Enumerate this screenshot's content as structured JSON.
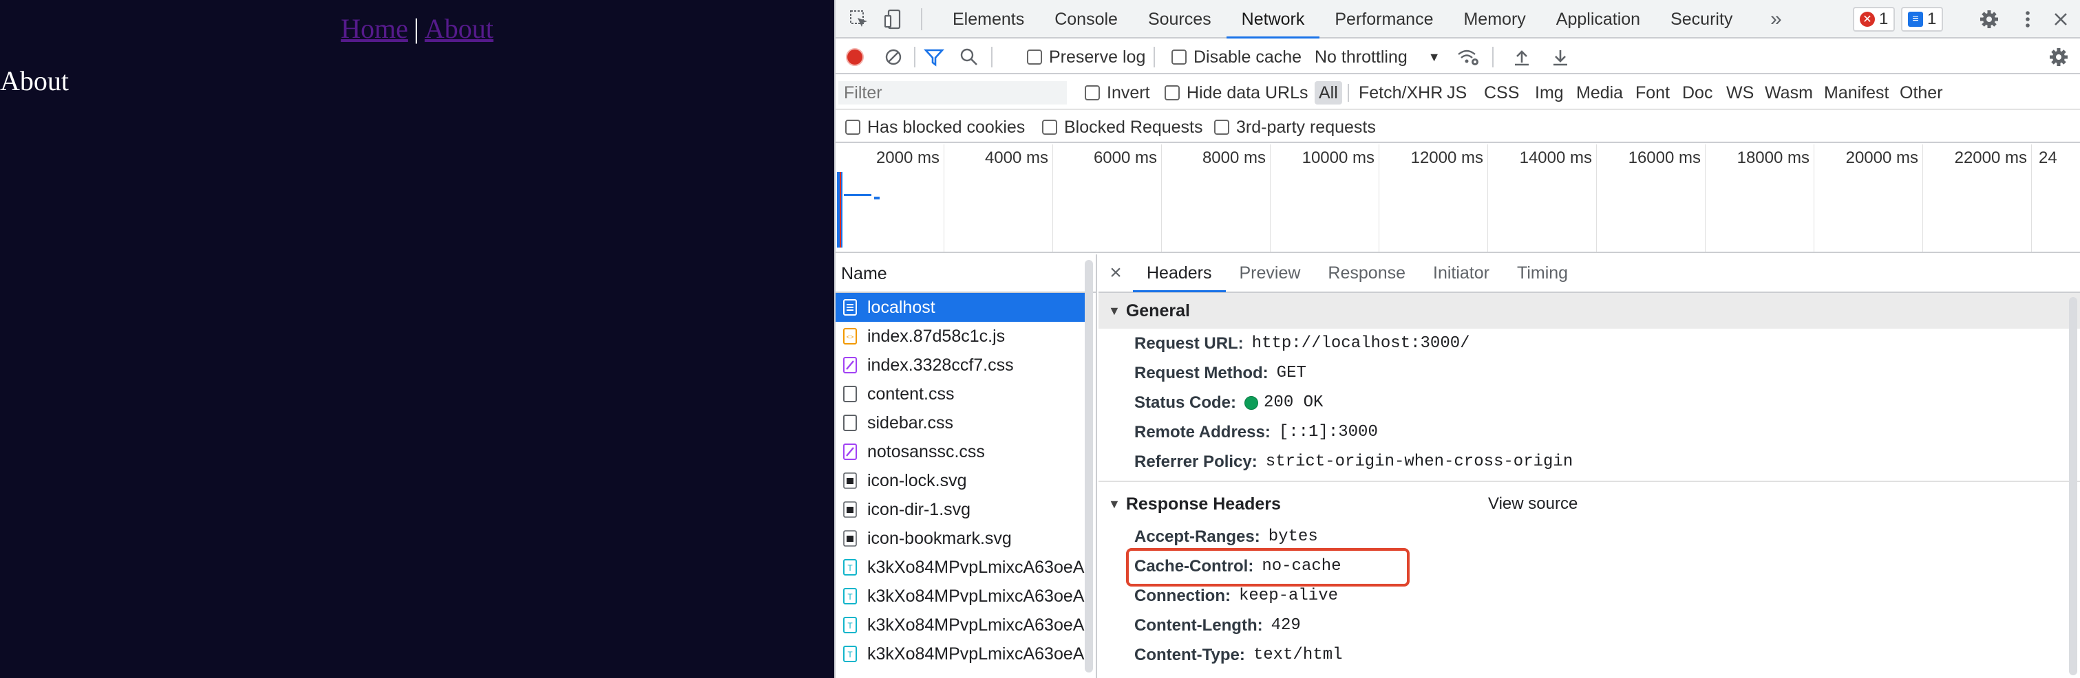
{
  "app": {
    "nav_home": "Home",
    "nav_separator": "|",
    "nav_about": "About",
    "heading": "About"
  },
  "devtools": {
    "tabs": [
      "Elements",
      "Console",
      "Sources",
      "Network",
      "Performance",
      "Memory",
      "Application",
      "Security"
    ],
    "active_tab": "Network",
    "more_tabs": "»",
    "error_count": "1",
    "message_count": "1",
    "toolbar": {
      "preserve_log": "Preserve log",
      "disable_cache": "Disable cache",
      "throttling": "No throttling"
    },
    "filter": {
      "placeholder": "Filter",
      "invert": "Invert",
      "hide_data_urls": "Hide data URLs",
      "types": [
        "All",
        "Fetch/XHR",
        "JS",
        "CSS",
        "Img",
        "Media",
        "Font",
        "Doc",
        "WS",
        "Wasm",
        "Manifest",
        "Other"
      ],
      "has_blocked_cookies": "Has blocked cookies",
      "blocked_requests": "Blocked Requests",
      "third_party": "3rd-party requests"
    },
    "timeline_ticks": [
      "2000 ms",
      "4000 ms",
      "6000 ms",
      "8000 ms",
      "10000 ms",
      "12000 ms",
      "14000 ms",
      "16000 ms",
      "18000 ms",
      "20000 ms",
      "22000 ms",
      "24"
    ],
    "requests": {
      "header": "Name",
      "items": [
        {
          "name": "localhost",
          "kind": "doc"
        },
        {
          "name": "index.87d58c1c.js",
          "kind": "js"
        },
        {
          "name": "index.3328ccf7.css",
          "kind": "css"
        },
        {
          "name": "content.css",
          "kind": "plain"
        },
        {
          "name": "sidebar.css",
          "kind": "plain"
        },
        {
          "name": "notosanssc.css",
          "kind": "css"
        },
        {
          "name": "icon-lock.svg",
          "kind": "img"
        },
        {
          "name": "icon-dir-1.svg",
          "kind": "img"
        },
        {
          "name": "icon-bookmark.svg",
          "kind": "img"
        },
        {
          "name": "k3kXo84MPvpLmixcA63oeA.",
          "kind": "font"
        },
        {
          "name": "k3kXo84MPvpLmixcA63oeA.",
          "kind": "font"
        },
        {
          "name": "k3kXo84MPvpLmixcA63oeA.",
          "kind": "font"
        },
        {
          "name": "k3kXo84MPvpLmixcA63oeA.",
          "kind": "font"
        }
      ]
    },
    "detail": {
      "close": "×",
      "tabs": [
        "Headers",
        "Preview",
        "Response",
        "Initiator",
        "Timing"
      ],
      "active_tab": "Headers",
      "general": {
        "title": "General",
        "rows": [
          {
            "key": "Request URL:",
            "value": "http://localhost:3000/"
          },
          {
            "key": "Request Method:",
            "value": "GET"
          },
          {
            "key": "Status Code:",
            "value": "200 OK"
          },
          {
            "key": "Remote Address:",
            "value": "[::1]:3000"
          },
          {
            "key": "Referrer Policy:",
            "value": "strict-origin-when-cross-origin"
          }
        ]
      },
      "response_headers": {
        "title": "Response Headers",
        "view_source": "View source",
        "rows": [
          {
            "key": "Accept-Ranges:",
            "value": "bytes"
          },
          {
            "key": "Cache-Control:",
            "value": "no-cache"
          },
          {
            "key": "Connection:",
            "value": "keep-alive"
          },
          {
            "key": "Content-Length:",
            "value": "429"
          },
          {
            "key": "Content-Type:",
            "value": "text/html"
          }
        ]
      }
    },
    "colors": {
      "accent": "#1a73e8",
      "highlight": "#e0452d",
      "record": "#d93025",
      "status_ok": "#0d9d58"
    }
  }
}
